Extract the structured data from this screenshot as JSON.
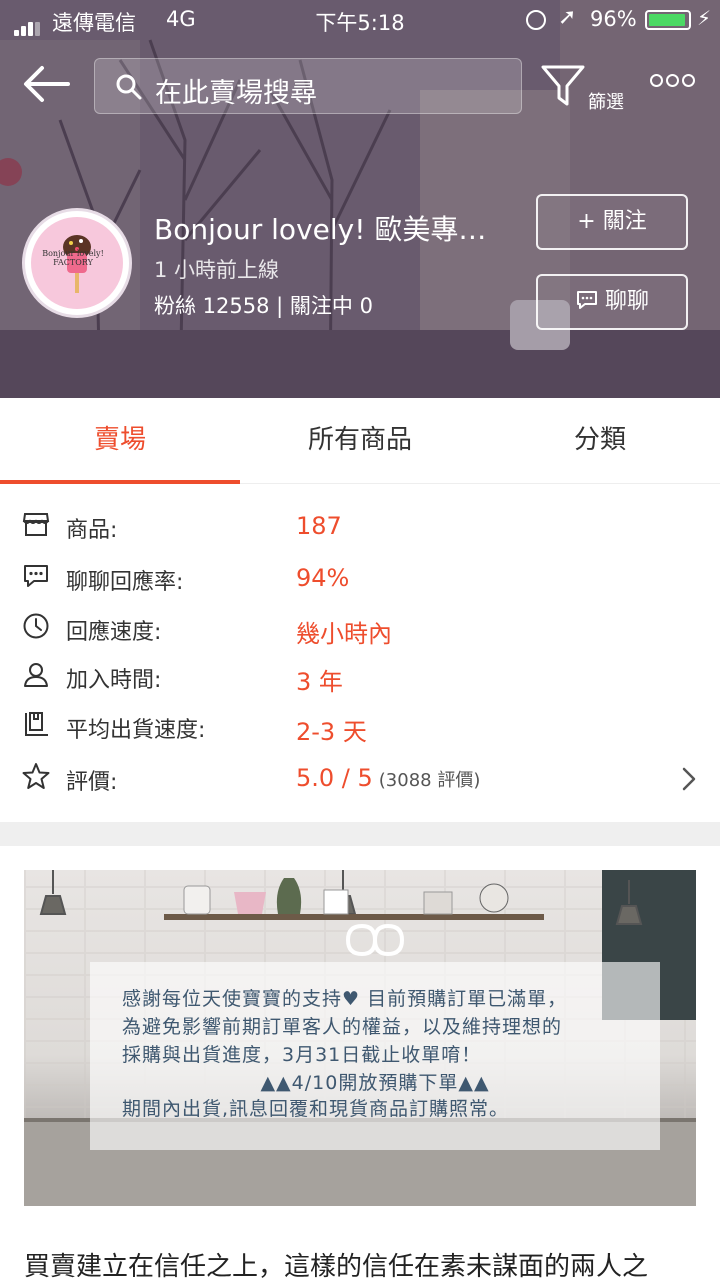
{
  "status_bar": {
    "carrier": "遠傳電信",
    "network": "4G",
    "time": "下午5:18",
    "battery": "96%",
    "battery_level": 0.96
  },
  "header": {
    "search_placeholder": "在此賣場搜尋",
    "filter_label": "篩選"
  },
  "shop": {
    "name": "Bonjour lovely! 歐美專…",
    "last_online": "1 小時前上線",
    "followers_line": "粉絲 12558 | 關注中 0",
    "follow_label": "+ 關注",
    "chat_label": "聊聊",
    "avatar_text": "Bonjour lovely! FACTORY"
  },
  "tabs": [
    {
      "label": "賣場",
      "active": true
    },
    {
      "label": "所有商品",
      "active": false
    },
    {
      "label": "分類",
      "active": false
    }
  ],
  "stats": [
    {
      "icon": "store-icon",
      "label": "商品:",
      "value": "187"
    },
    {
      "icon": "chat-bubble-icon",
      "label": "聊聊回應率:",
      "value": "94%"
    },
    {
      "icon": "clock-icon",
      "label": "回應速度:",
      "value": "幾小時內"
    },
    {
      "icon": "user-icon",
      "label": "加入時間:",
      "value": "3 年"
    },
    {
      "icon": "shipping-icon",
      "label": "平均出貨速度:",
      "value": "2-3 天"
    },
    {
      "icon": "star-icon",
      "label": "評價:",
      "value": "5.0 / 5",
      "extra": "(3088 評價)"
    }
  ],
  "banner": {
    "lines": [
      "感謝每位天使寶寶的支持♥ 目前預購訂單已滿單，",
      "為避免影響前期訂單客人的權益，以及維持理想的",
      "採購與出貨進度，3月31日截止收單唷！",
      "▲▲4/10開放預購下單▲▲",
      "期間內出貨,訊息回覆和現貨商品訂購照常。"
    ]
  },
  "description": "買賣建立在信任之上，這樣的信任在素未謀面的兩人之",
  "colors": {
    "accent": "#ee4d2d",
    "battery": "#4cd964"
  }
}
